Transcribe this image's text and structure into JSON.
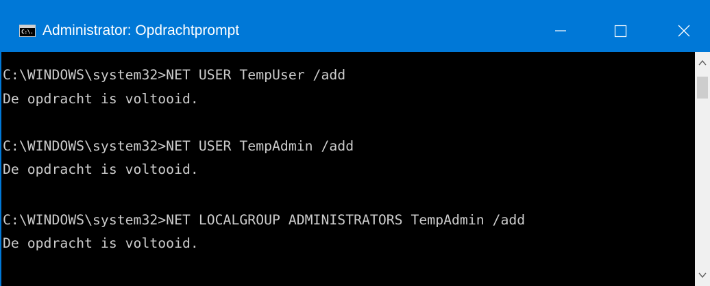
{
  "window": {
    "title": "Administrator: Opdrachtprompt",
    "icon": "cmd-console-icon",
    "icon_glyph": "C:\\.",
    "controls": {
      "minimize": "minimize-icon",
      "maximize": "maximize-icon",
      "close": "close-icon"
    },
    "accent_color": "#0078d7"
  },
  "console": {
    "background": "#000000",
    "text_color": "#cccccc",
    "lines": [
      "C:\\WINDOWS\\system32>NET USER TempUser /add",
      "De opdracht is voltooid.",
      "",
      "C:\\WINDOWS\\system32>NET USER TempAdmin /add",
      "De opdracht is voltooid.",
      "",
      "C:\\WINDOWS\\system32>NET LOCALGROUP ADMINISTRATORS TempAdmin /add",
      "De opdracht is voltooid."
    ]
  },
  "scrollbar": {
    "up_icon": "chevron-up-icon",
    "down_icon": "chevron-down-icon"
  }
}
